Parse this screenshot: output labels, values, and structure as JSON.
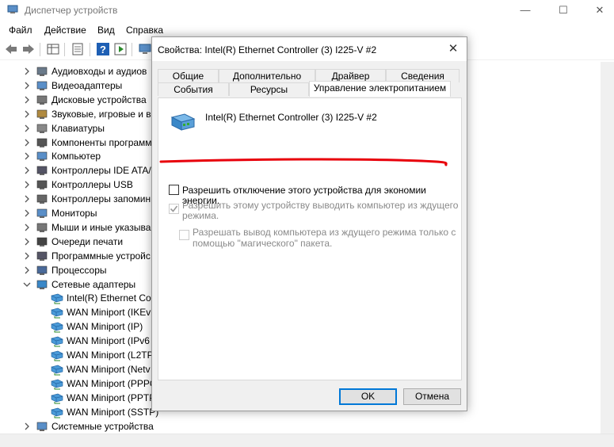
{
  "window": {
    "title": "Диспетчер устройств",
    "controls": {
      "minimize": "—",
      "maximize": "☐",
      "close": "✕"
    }
  },
  "menu": [
    "Файл",
    "Действие",
    "Вид",
    "Справка"
  ],
  "tree": {
    "items": [
      {
        "label": "Аудиовходы и аудиов",
        "expanded": false
      },
      {
        "label": "Видеоадаптеры",
        "expanded": false
      },
      {
        "label": "Дисковые устройства",
        "expanded": false
      },
      {
        "label": "Звуковые, игровые и в",
        "expanded": false
      },
      {
        "label": "Клавиатуры",
        "expanded": false
      },
      {
        "label": "Компоненты программ",
        "expanded": false
      },
      {
        "label": "Компьютер",
        "expanded": false
      },
      {
        "label": "Контроллеры IDE ATA/",
        "expanded": false
      },
      {
        "label": "Контроллеры USB",
        "expanded": false
      },
      {
        "label": "Контроллеры запомин",
        "expanded": false
      },
      {
        "label": "Мониторы",
        "expanded": false
      },
      {
        "label": "Мыши и иные указыва",
        "expanded": false
      },
      {
        "label": "Очереди печати",
        "expanded": false
      },
      {
        "label": "Программные устройс",
        "expanded": false
      },
      {
        "label": "Процессоры",
        "expanded": false
      },
      {
        "label": "Сетевые адаптеры",
        "expanded": true
      }
    ],
    "children": [
      "Intel(R) Ethernet Cor",
      "WAN Miniport (IKEv",
      "WAN Miniport (IP)",
      "WAN Miniport (IPv6",
      "WAN Miniport (L2TP",
      "WAN Miniport (Netv",
      "WAN Miniport (PPPO",
      "WAN Miniport (PPTP",
      "WAN Miniport (SSTP)"
    ],
    "last_item": "Системные устройства"
  },
  "dialog": {
    "title": "Свойства: Intel(R) Ethernet Controller (3) I225-V #2",
    "close": "✕",
    "tabs_row1": [
      "Общие",
      "Дополнительно",
      "Драйвер",
      "Сведения"
    ],
    "tabs_row2": [
      "События",
      "Ресурсы",
      "Управление электропитанием"
    ],
    "active_tab": "Управление электропитанием",
    "device_name": "Intel(R) Ethernet Controller (3) I225-V #2",
    "options": [
      {
        "label": "Разрешить отключение этого устройства для экономии энергии.",
        "checked": false,
        "enabled": true
      },
      {
        "label_line1": "Разрешить этому устройству выводить компьютер из ждущего",
        "label_line2": "режима.",
        "checked": true,
        "enabled": false
      },
      {
        "label_line1": "Разрешать вывод компьютера из ждущего режима только с",
        "label_line2": "помощью \"магического\" пакета.",
        "checked": false,
        "enabled": false
      }
    ],
    "buttons": {
      "ok": "OK",
      "cancel": "Отмена"
    }
  },
  "colors": {
    "accent": "#0078d7",
    "annotation": "#e8000b"
  }
}
